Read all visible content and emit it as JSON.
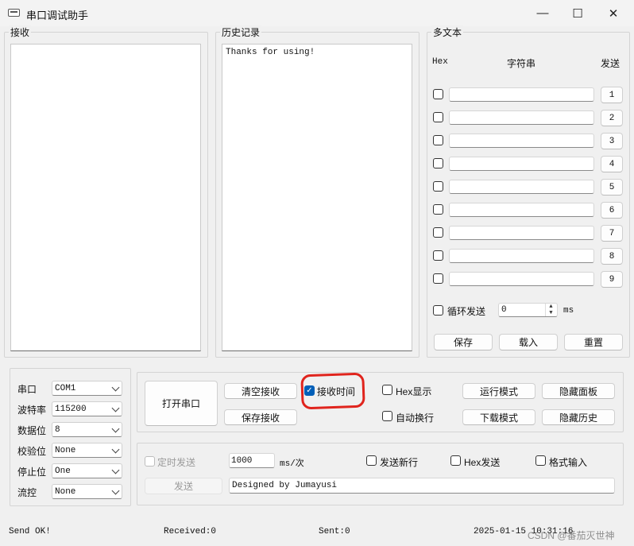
{
  "window": {
    "title": "串口调试助手",
    "minimize_glyph": "—",
    "maximize_glyph": "☐",
    "close_glyph": "✕"
  },
  "receive": {
    "label": "接收",
    "content": ""
  },
  "history": {
    "label": "历史记录",
    "content": "Thanks for using!"
  },
  "multi_text": {
    "label": "多文本",
    "col_hex": "Hex",
    "col_string": "字符串",
    "col_send": "发送",
    "rows": [
      {
        "checked": false,
        "value": "",
        "button": "1"
      },
      {
        "checked": false,
        "value": "",
        "button": "2"
      },
      {
        "checked": false,
        "value": "",
        "button": "3"
      },
      {
        "checked": false,
        "value": "",
        "button": "4"
      },
      {
        "checked": false,
        "value": "",
        "button": "5"
      },
      {
        "checked": false,
        "value": "",
        "button": "6"
      },
      {
        "checked": false,
        "value": "",
        "button": "7"
      },
      {
        "checked": false,
        "value": "",
        "button": "8"
      },
      {
        "checked": false,
        "value": "",
        "button": "9"
      }
    ],
    "loop_send_label": "循环发送",
    "loop_interval": "0",
    "loop_unit": "ms",
    "save_button": "保存",
    "load_button": "载入",
    "reset_button": "重置"
  },
  "serial": {
    "port_label": "串口",
    "port_value": "COM1",
    "baud_label": "波特率",
    "baud_value": "115200",
    "databits_label": "数据位",
    "databits_value": "8",
    "parity_label": "校验位",
    "parity_value": "None",
    "stopbits_label": "停止位",
    "stopbits_value": "One",
    "flow_label": "流控",
    "flow_value": "None"
  },
  "controls": {
    "open_port": "打开串口",
    "clear_receive": "清空接收",
    "save_receive": "保存接收",
    "receive_time": "接收时间",
    "receive_time_checked": true,
    "hex_display": "Hex显示",
    "auto_newline": "自动换行",
    "run_mode": "运行模式",
    "download_mode": "下载模式",
    "hide_panel": "隐藏面板",
    "hide_history": "隐藏历史"
  },
  "send": {
    "timed_send": "定时发送",
    "interval_value": "1000",
    "interval_unit": "ms/次",
    "send_newline": "发送新行",
    "hex_send": "Hex发送",
    "format_input": "格式输入",
    "send_button": "发送",
    "send_text": "Designed by Jumayusi"
  },
  "status": {
    "message": "Send OK!",
    "received": "Received:0",
    "sent": "Sent:0",
    "datetime": "2025-01-15  10:31:16",
    "watermark": "CSDN @番茄灭世神"
  },
  "colors": {
    "accent": "#005fb8",
    "annotation": "#e0241d"
  }
}
